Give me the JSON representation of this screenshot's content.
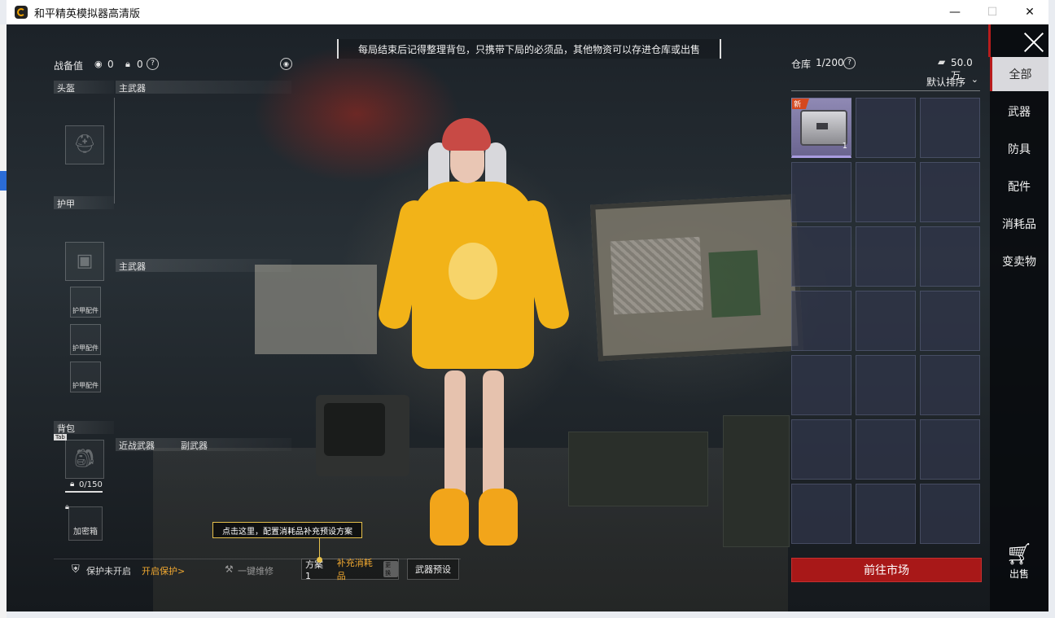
{
  "window": {
    "title": "和平精英模拟器高清版",
    "minimize": "—",
    "maximize": "☐",
    "close": "✕"
  },
  "notice": "每局结束后记得整理背包，只携带下局的必须品，其他物资可以存进仓库或出售",
  "left_panel": {
    "gear_value_label": "战备值",
    "gear_value": "0",
    "lock_value": "0",
    "help": "?",
    "helmet": "头盔",
    "primary1": "主武器",
    "armor": "护甲",
    "primary2": "主武器",
    "armor_parts": [
      "护甲配件",
      "护甲配件",
      "护甲配件"
    ],
    "backpack": "背包",
    "tab_badge": "Tab",
    "melee": "近战武器",
    "secondary": "副武器",
    "capacity": "0/150",
    "secure_box": "加密箱"
  },
  "bottom_bar": {
    "protect_status": "保护未开启",
    "enable_protect": "开启保护>",
    "repair": "一键维修",
    "plan": "方案1",
    "supply": "补充消耗品",
    "supply_badge": "更换",
    "weapon_preset": "武器预设",
    "tooltip": "点击这里，配置消耗品补充预设方案"
  },
  "warehouse": {
    "label": "仓库",
    "capacity": "1/200",
    "help": "?",
    "money": "50.0万",
    "sort": "默认排序",
    "items": [
      {
        "tag": "新",
        "qty": "1",
        "icon": "supply-box-icon"
      }
    ],
    "market_button": "前往市场"
  },
  "tabs": [
    "全部",
    "武器",
    "防具",
    "配件",
    "消耗品",
    "变卖物"
  ],
  "active_tab": "全部",
  "sell": "出售",
  "colors": {
    "accent_red": "#a81818",
    "tip_yellow": "#e5c04c",
    "enable_orange": "#f0a830"
  }
}
